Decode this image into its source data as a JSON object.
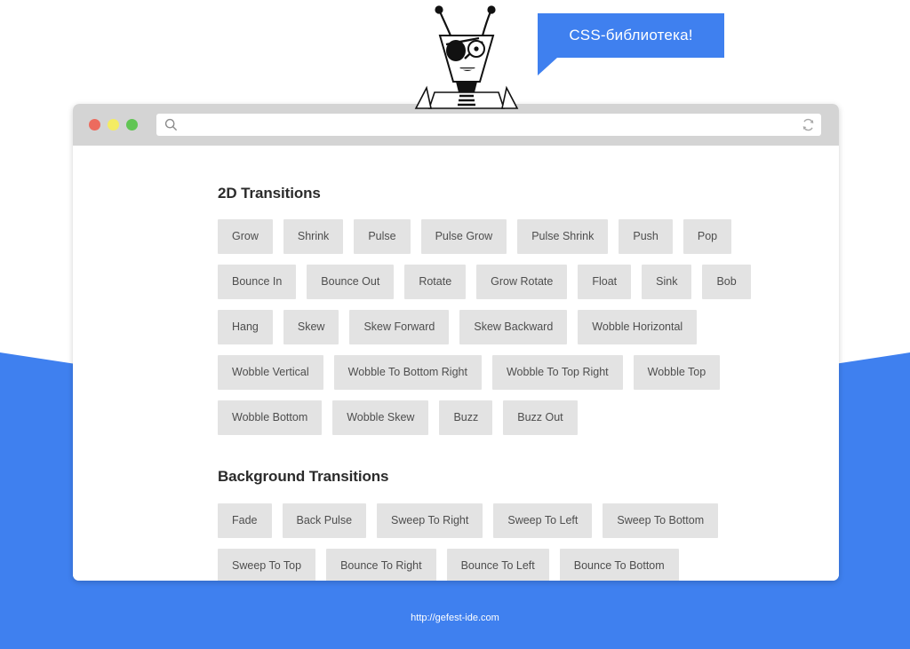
{
  "theme": {
    "accent_blue": "#3f80ef",
    "titlebar_gray": "#d4d4d4",
    "button_gray": "#e3e3e3",
    "button_text": "#4e4e4e",
    "light_red": "#ec6b5e",
    "light_yellow": "#f4ec62",
    "light_green": "#61c554"
  },
  "mascot": {
    "icon": "robot-mascot-icon",
    "bubble_text": "CSS-библиотека!"
  },
  "browser": {
    "lights": [
      {
        "name": "close",
        "color": "#ec6b5e"
      },
      {
        "name": "minimize",
        "color": "#f4ec62"
      },
      {
        "name": "maximize",
        "color": "#61c554"
      }
    ],
    "address_value": "",
    "address_placeholder": "",
    "search_icon": "search-icon",
    "reload_icon": "reload-icon"
  },
  "sections": [
    {
      "id": "2d-transitions",
      "title": "2D Transitions",
      "rows": [
        [
          "Grow",
          "Shrink",
          "Pulse",
          "Pulse Grow",
          "Pulse Shrink",
          "Push",
          "Pop"
        ],
        [
          "Bounce In",
          "Bounce Out",
          "Rotate",
          "Grow Rotate",
          "Float",
          "Sink",
          "Bob"
        ],
        [
          "Hang",
          "Skew",
          "Skew Forward",
          "Skew Backward",
          "Wobble Horizontal"
        ],
        [
          "Wobble Vertical",
          "Wobble To Bottom Right",
          "Wobble To Top Right",
          "Wobble Top"
        ],
        [
          "Wobble Bottom",
          "Wobble Skew",
          "Buzz",
          "Buzz Out"
        ]
      ]
    },
    {
      "id": "background-transitions",
      "title": "Background Transitions",
      "rows": [
        [
          "Fade",
          "Back Pulse",
          "Sweep To Right",
          "Sweep To Left",
          "Sweep To Bottom"
        ],
        [
          "Sweep To Top",
          "Bounce To Right",
          "Bounce To Left",
          "Bounce To Bottom"
        ]
      ]
    }
  ],
  "footer": {
    "url": "http://gefest-ide.com"
  }
}
